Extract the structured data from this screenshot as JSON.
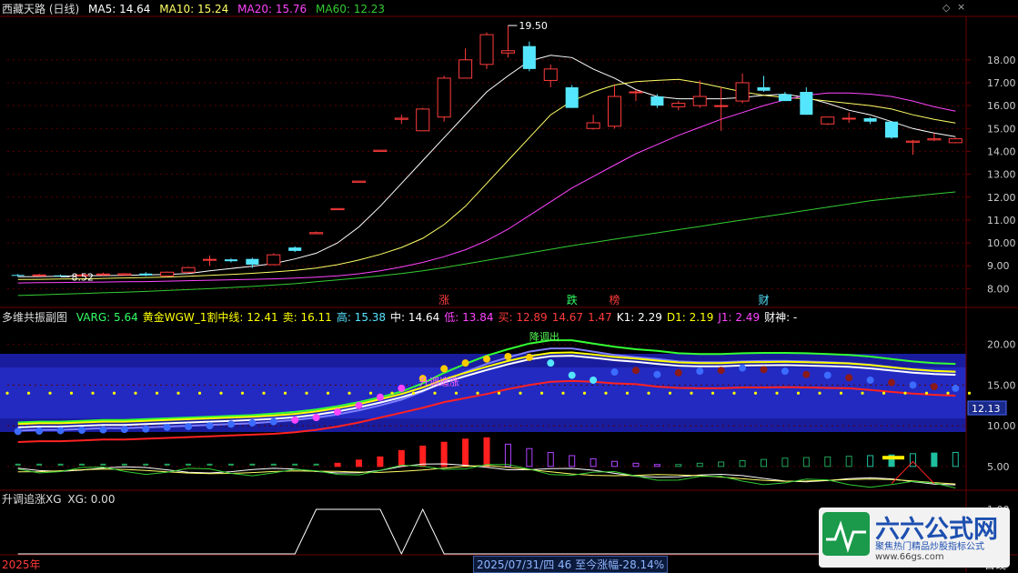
{
  "colors": {
    "bg": "#000000",
    "grid": "#5a0000",
    "axis": "#6b0000",
    "up": "#ff3b3b",
    "down": "#55e6ff",
    "ma5": "#ffffff",
    "ma10": "#ffff66",
    "ma20": "#ff44ff",
    "ma60": "#33cc33"
  },
  "main_panel": {
    "title": "西藏天路 (日线)",
    "ma5": "MA5: 14.64",
    "ma10": "MA10: 15.24",
    "ma20": "MA20: 15.76",
    "ma60": "MA60: 12.23"
  },
  "sub1": {
    "title": "多维共振副图",
    "items": [
      {
        "text": "VARG: 5.64",
        "color": "#33ff66"
      },
      {
        "text": "黄金WGW_1割中线: 12.41",
        "color": "#ffff00"
      },
      {
        "text": "卖: 16.11",
        "color": "#ffff00"
      },
      {
        "text": "高: 15.38",
        "color": "#55e6ff"
      },
      {
        "text": "中: 14.64",
        "color": "#ffffff"
      },
      {
        "text": "低: 13.84",
        "color": "#ff44ff"
      },
      {
        "text": "买: 12.89",
        "color": "#ff3b3b"
      },
      {
        "text": "14.67",
        "color": "#ff3b3b"
      },
      {
        "text": "1.47",
        "color": "#ff3b3b"
      },
      {
        "text": "K1: 2.29",
        "color": "#ffffff"
      },
      {
        "text": "D1: 2.19",
        "color": "#ffff00"
      },
      {
        "text": "J1: 2.49",
        "color": "#ff44ff"
      },
      {
        "text": "财神: -",
        "color": "#ffffff"
      }
    ],
    "label_reset": "降调出",
    "label_chase": "升调追涨",
    "value_tag": "12.13"
  },
  "sub2": {
    "title": "升调追涨XG",
    "value": "XG: 0.00"
  },
  "markers": [
    {
      "text": "涨",
      "color": "#ff3b3b",
      "i": 20
    },
    {
      "text": "跌",
      "color": "#33ff66",
      "i": 26
    },
    {
      "text": "榜",
      "color": "#ff3b3b",
      "i": 28
    },
    {
      "text": "财",
      "color": "#55e6ff",
      "i": 35
    }
  ],
  "footer": {
    "year": "2025年",
    "info": "2025/07/31/四 46 至今涨幅-28.14%",
    "period": "日线",
    "watermark_site": "www.66gs.com",
    "watermark_brand": "六六公式网",
    "watermark_slogan": "聚焦热门精品炒股指标公式"
  },
  "chart_data": [
    {
      "type": "candlestick",
      "title": "西藏天路 (日线)",
      "ylim": [
        7.3,
        19.9
      ],
      "yticks": [
        8,
        9,
        10,
        11,
        12,
        13,
        14,
        15,
        16,
        17,
        18
      ],
      "annotations": [
        {
          "text": "19.50",
          "i": 23,
          "value": 19.5
        },
        {
          "text": "8.52",
          "i": 2,
          "value": 8.52
        }
      ],
      "candles": [
        {
          "o": 8.6,
          "h": 8.64,
          "l": 8.52,
          "c": 8.58
        },
        {
          "o": 8.58,
          "h": 8.65,
          "l": 8.55,
          "c": 8.6
        },
        {
          "o": 8.58,
          "h": 8.62,
          "l": 8.52,
          "c": 8.56
        },
        {
          "o": 8.56,
          "h": 8.66,
          "l": 8.54,
          "c": 8.6
        },
        {
          "o": 8.62,
          "h": 8.7,
          "l": 8.58,
          "c": 8.64
        },
        {
          "o": 8.6,
          "h": 8.68,
          "l": 8.56,
          "c": 8.65
        },
        {
          "o": 8.66,
          "h": 8.72,
          "l": 8.55,
          "c": 8.58
        },
        {
          "o": 8.56,
          "h": 8.75,
          "l": 8.52,
          "c": 8.72
        },
        {
          "o": 8.72,
          "h": 8.95,
          "l": 8.68,
          "c": 8.92
        },
        {
          "o": 9.25,
          "h": 9.45,
          "l": 9.0,
          "c": 9.28
        },
        {
          "o": 9.28,
          "h": 9.32,
          "l": 9.15,
          "c": 9.2
        },
        {
          "o": 9.3,
          "h": 9.35,
          "l": 8.9,
          "c": 9.05
        },
        {
          "o": 9.05,
          "h": 9.55,
          "l": 9.02,
          "c": 9.48
        },
        {
          "o": 9.8,
          "h": 9.85,
          "l": 9.6,
          "c": 9.65
        },
        {
          "o": 10.4,
          "h": 10.5,
          "l": 10.4,
          "c": 10.45
        },
        {
          "o": 11.45,
          "h": 11.5,
          "l": 11.45,
          "c": 11.5
        },
        {
          "o": 12.65,
          "h": 12.7,
          "l": 12.65,
          "c": 12.7
        },
        {
          "o": 14.0,
          "h": 14.05,
          "l": 14.0,
          "c": 14.05
        },
        {
          "o": 15.4,
          "h": 15.6,
          "l": 15.2,
          "c": 15.45
        },
        {
          "o": 14.9,
          "h": 15.9,
          "l": 14.9,
          "c": 15.85
        },
        {
          "o": 15.5,
          "h": 17.3,
          "l": 15.3,
          "c": 17.2
        },
        {
          "o": 17.2,
          "h": 18.5,
          "l": 17.2,
          "c": 18.0
        },
        {
          "o": 17.8,
          "h": 19.2,
          "l": 17.6,
          "c": 19.1
        },
        {
          "o": 18.3,
          "h": 19.5,
          "l": 18.1,
          "c": 18.4
        },
        {
          "o": 18.6,
          "h": 18.8,
          "l": 17.5,
          "c": 17.6
        },
        {
          "o": 17.1,
          "h": 17.8,
          "l": 16.8,
          "c": 17.6
        },
        {
          "o": 16.8,
          "h": 16.9,
          "l": 15.9,
          "c": 15.9
        },
        {
          "o": 15.0,
          "h": 15.6,
          "l": 14.95,
          "c": 15.25
        },
        {
          "o": 15.1,
          "h": 16.9,
          "l": 15.0,
          "c": 16.4
        },
        {
          "o": 16.6,
          "h": 16.7,
          "l": 16.2,
          "c": 16.6
        },
        {
          "o": 16.4,
          "h": 16.5,
          "l": 15.9,
          "c": 16.0
        },
        {
          "o": 15.95,
          "h": 16.2,
          "l": 15.8,
          "c": 16.1
        },
        {
          "o": 16.0,
          "h": 17.1,
          "l": 15.9,
          "c": 16.4
        },
        {
          "o": 16.0,
          "h": 16.8,
          "l": 14.9,
          "c": 16.0
        },
        {
          "o": 16.2,
          "h": 17.4,
          "l": 16.1,
          "c": 17.0
        },
        {
          "o": 16.8,
          "h": 17.3,
          "l": 16.6,
          "c": 16.65
        },
        {
          "o": 16.5,
          "h": 16.6,
          "l": 16.2,
          "c": 16.2
        },
        {
          "o": 16.6,
          "h": 16.8,
          "l": 15.6,
          "c": 15.6
        },
        {
          "o": 15.2,
          "h": 15.5,
          "l": 15.15,
          "c": 15.5
        },
        {
          "o": 15.45,
          "h": 15.7,
          "l": 15.25,
          "c": 15.45
        },
        {
          "o": 15.45,
          "h": 15.5,
          "l": 15.2,
          "c": 15.3
        },
        {
          "o": 15.3,
          "h": 15.3,
          "l": 14.55,
          "c": 14.6
        },
        {
          "o": 14.4,
          "h": 14.5,
          "l": 13.85,
          "c": 14.45
        },
        {
          "o": 14.5,
          "h": 14.8,
          "l": 14.45,
          "c": 14.55
        },
        {
          "o": 14.38,
          "h": 14.6,
          "l": 14.35,
          "c": 14.55
        }
      ],
      "series": [
        {
          "name": "MA5",
          "values": [
            8.52,
            8.53,
            8.54,
            8.56,
            8.57,
            8.58,
            8.6,
            8.62,
            8.66,
            8.78,
            8.88,
            8.98,
            9.1,
            9.3,
            9.55,
            10.0,
            10.7,
            11.6,
            12.6,
            13.6,
            14.6,
            15.6,
            16.6,
            17.3,
            17.95,
            18.2,
            18.1,
            17.6,
            17.2,
            16.7,
            16.4,
            16.3,
            16.3,
            16.3,
            16.35,
            16.45,
            16.5,
            16.35,
            16.1,
            15.8,
            15.6,
            15.3,
            15.0,
            14.8,
            14.64
          ]
        },
        {
          "name": "MA10",
          "values": [
            8.4,
            8.41,
            8.42,
            8.43,
            8.45,
            8.47,
            8.49,
            8.51,
            8.54,
            8.58,
            8.62,
            8.67,
            8.73,
            8.8,
            8.9,
            9.05,
            9.25,
            9.5,
            9.8,
            10.2,
            10.8,
            11.6,
            12.6,
            13.6,
            14.6,
            15.6,
            16.2,
            16.6,
            16.9,
            17.05,
            17.1,
            17.15,
            17.0,
            16.8,
            16.6,
            16.45,
            16.35,
            16.3,
            16.2,
            16.1,
            16.0,
            15.85,
            15.6,
            15.4,
            15.24
          ]
        },
        {
          "name": "MA20",
          "values": [
            8.25,
            8.26,
            8.27,
            8.28,
            8.29,
            8.3,
            8.31,
            8.33,
            8.35,
            8.37,
            8.39,
            8.41,
            8.43,
            8.46,
            8.5,
            8.56,
            8.65,
            8.78,
            8.95,
            9.15,
            9.4,
            9.7,
            10.1,
            10.6,
            11.2,
            11.8,
            12.4,
            12.9,
            13.4,
            13.9,
            14.3,
            14.7,
            15.05,
            15.4,
            15.7,
            16.0,
            16.25,
            16.45,
            16.55,
            16.55,
            16.5,
            16.4,
            16.2,
            15.95,
            15.76
          ]
        },
        {
          "name": "MA60",
          "values": [
            7.7,
            7.73,
            7.76,
            7.79,
            7.82,
            7.85,
            7.88,
            7.92,
            7.96,
            8.0,
            8.05,
            8.1,
            8.16,
            8.22,
            8.3,
            8.38,
            8.47,
            8.56,
            8.66,
            8.78,
            8.92,
            9.08,
            9.24,
            9.4,
            9.56,
            9.72,
            9.88,
            10.02,
            10.16,
            10.3,
            10.44,
            10.58,
            10.72,
            10.86,
            11.0,
            11.14,
            11.28,
            11.42,
            11.56,
            11.7,
            11.84,
            11.94,
            12.04,
            12.14,
            12.23
          ]
        }
      ]
    },
    {
      "type": "line",
      "title": "多维共振副图",
      "ylim": [
        2.3,
        22.3
      ],
      "yticks": [
        5,
        10,
        15,
        20
      ],
      "band_low": [
        8.8,
        8.9,
        8.9,
        9.0,
        9.1,
        9.1,
        9.2,
        9.3,
        9.4,
        9.5,
        9.6,
        9.7,
        9.8,
        10.0,
        10.3,
        10.7,
        11.2,
        11.8,
        12.4,
        13.0,
        13.7,
        14.2,
        14.7,
        15.3,
        15.8,
        16.2,
        16.3,
        16.2,
        16.0,
        15.9,
        15.6,
        15.45,
        15.4,
        15.4,
        15.5,
        15.5,
        15.55,
        15.5,
        15.45,
        15.4,
        15.2,
        14.95,
        14.75,
        14.6,
        14.5
      ],
      "band_high": [
        9.8,
        9.9,
        9.9,
        10.0,
        10.1,
        10.1,
        10.2,
        10.3,
        10.4,
        10.5,
        10.6,
        10.7,
        10.9,
        11.1,
        11.4,
        11.8,
        12.3,
        12.9,
        13.6,
        14.6,
        15.9,
        17.0,
        18.0,
        18.8,
        19.5,
        19.9,
        19.9,
        19.5,
        19.1,
        18.8,
        18.6,
        18.3,
        18.2,
        18.2,
        18.3,
        18.35,
        18.35,
        18.3,
        18.2,
        18.1,
        17.9,
        17.6,
        17.3,
        17.1,
        17.0
      ],
      "signals": [
        9.3,
        9.35,
        9.4,
        9.45,
        9.5,
        9.55,
        9.6,
        9.8,
        9.9,
        10.0,
        10.2,
        10.35,
        10.5,
        10.7,
        11.0,
        11.7,
        12.5,
        13.5,
        14.6,
        15.8,
        17.0,
        17.7,
        18.2,
        18.5,
        18.4,
        17.7,
        16.2,
        15.6,
        16.6,
        16.8,
        16.3,
        16.5,
        16.7,
        16.8,
        17.1,
        16.9,
        16.7,
        16.3,
        16.2,
        15.9,
        15.6,
        15.3,
        15.0,
        14.8,
        14.6
      ],
      "yellow_dots_level": 14.0,
      "kdj_level": 5.0,
      "bars": [
        0,
        0,
        0,
        0,
        0,
        0,
        0,
        0,
        0,
        0,
        0,
        0,
        0,
        0,
        0,
        0.5,
        1.0,
        1.5,
        2.5,
        3.2,
        3.8,
        4.3,
        4.5,
        3.5,
        2.8,
        2.2,
        1.7,
        1.2,
        0.8,
        0.5,
        0.3,
        -0.3,
        -0.5,
        -0.7,
        -0.9,
        -1.1,
        -1.3,
        -1.4,
        -1.5,
        -1.6,
        -1.7,
        -1.8,
        -2.0,
        -2.1,
        -2.2
      ]
    },
    {
      "type": "line",
      "title": "升调追涨XG",
      "ylim": [
        0,
        1
      ],
      "yticks": [
        0.0,
        0.5,
        1.0
      ],
      "values": [
        0,
        0,
        0,
        0,
        0,
        0,
        0,
        0,
        0,
        0,
        0,
        0,
        0,
        0,
        1,
        1,
        1,
        1,
        0,
        1,
        0,
        0,
        0,
        0,
        0,
        0,
        0,
        0,
        0,
        0,
        0,
        0,
        0,
        0,
        0,
        0,
        0,
        0,
        0,
        0,
        0,
        0,
        0,
        0,
        0
      ]
    }
  ]
}
